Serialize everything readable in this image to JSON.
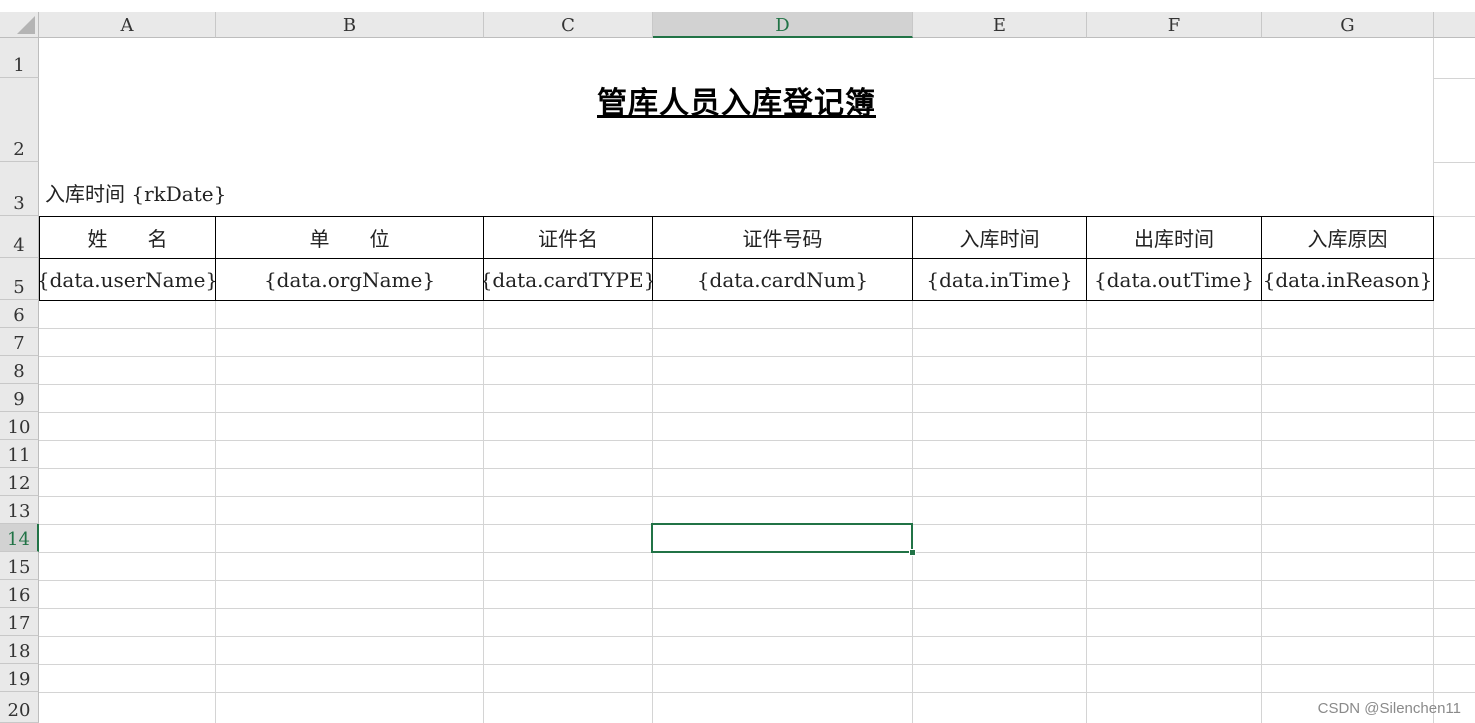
{
  "columns": [
    "A",
    "B",
    "C",
    "D",
    "E",
    "F",
    "G"
  ],
  "selected_column": "D",
  "rows": [
    "1",
    "2",
    "3",
    "4",
    "5",
    "6",
    "7",
    "8",
    "9",
    "10",
    "11",
    "12",
    "13",
    "14",
    "15",
    "16",
    "17",
    "18",
    "19",
    "20"
  ],
  "selected_row": "14",
  "sheet": {
    "title": "管库人员入库登记簿",
    "date_label": "入库时间 {rkDate}",
    "header": [
      "姓　　名",
      "单　　位",
      "证件名",
      "证件号码",
      "入库时间",
      "出库时间",
      "入库原因"
    ],
    "template_row": [
      "{data.userName}",
      "{data.orgName}",
      "{data.cardTYPE}",
      "{data.cardNum}",
      "{data.inTime}",
      "{data.outTime}",
      "{data.inReason}"
    ]
  },
  "active_cell": "D14",
  "accent_color": "#217346",
  "watermark": "CSDN @Silenchen11"
}
